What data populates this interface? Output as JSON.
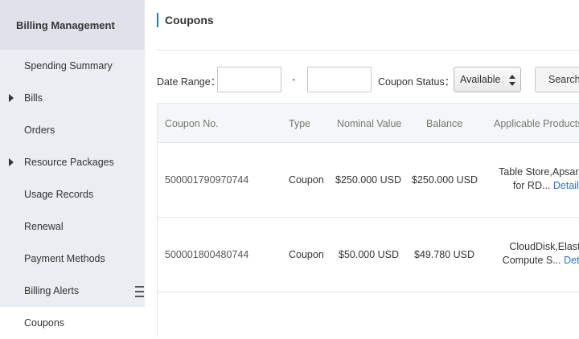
{
  "sidebar": {
    "header": "Billing Management",
    "items": [
      {
        "label": "Spending Summary",
        "expandable": false,
        "active": false
      },
      {
        "label": "Bills",
        "expandable": true,
        "active": false
      },
      {
        "label": "Orders",
        "expandable": false,
        "active": false
      },
      {
        "label": "Resource Packages",
        "expandable": true,
        "active": false
      },
      {
        "label": "Usage Records",
        "expandable": false,
        "active": false
      },
      {
        "label": "Renewal",
        "expandable": false,
        "active": false
      },
      {
        "label": "Payment Methods",
        "expandable": false,
        "active": false
      },
      {
        "label": "Billing Alerts",
        "expandable": false,
        "active": false
      },
      {
        "label": "Coupons",
        "expandable": false,
        "active": true
      }
    ]
  },
  "page": {
    "title": "Coupons"
  },
  "filters": {
    "date_range_label": "Date Range：",
    "date_separator": "-",
    "start_date_value": "",
    "end_date_value": "",
    "coupon_status_label": "Coupon Status：",
    "coupon_status_selected": "Available",
    "search_label": "Search"
  },
  "table": {
    "columns": [
      "Coupon No.",
      "Type",
      "Nominal Value",
      "Balance",
      "Applicable Products"
    ],
    "rows": [
      {
        "coupon_no": "500001790970744",
        "type": "Coupon",
        "nominal_value": "$250.000 USD",
        "balance": "$250.000 USD",
        "products_line1": "Table Store,ApsaraDB",
        "products_line2": "for RD...",
        "details_label": "Details"
      },
      {
        "coupon_no": "500001800480744",
        "type": "Coupon",
        "nominal_value": "$50.000 USD",
        "balance": "$49.780 USD",
        "products_line1": "CloudDisk,Elastic",
        "products_line2": "Compute S...",
        "details_label": "Details"
      }
    ]
  },
  "colors": {
    "accent": "#2c6fcf",
    "sidebar_bg": "#eaedf1",
    "sidebar_header_bg": "#dfe3e9",
    "table_header_bg": "#f5f6f7"
  }
}
